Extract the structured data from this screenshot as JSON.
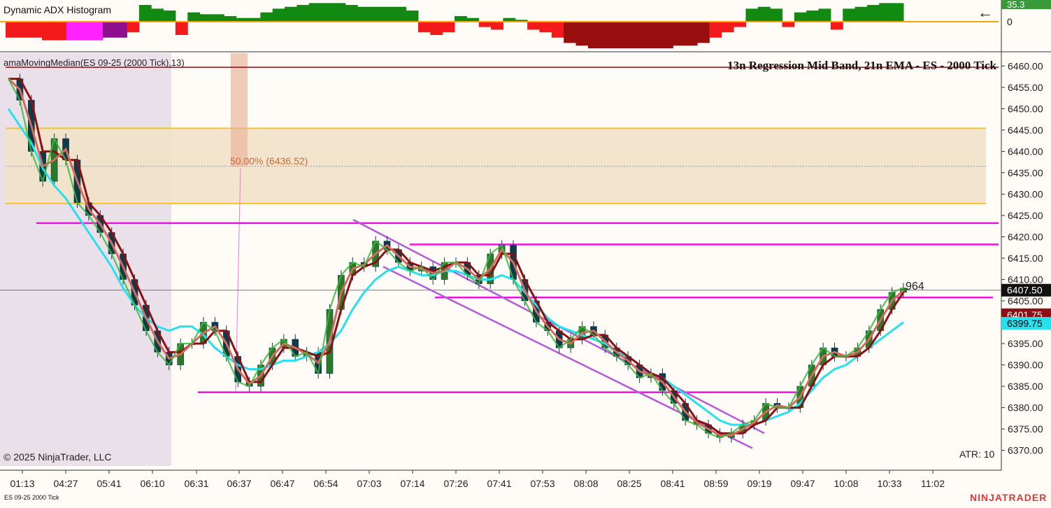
{
  "indicator_panel": {
    "title": "Dynamic ADX Histogram",
    "value_badge": "35.3",
    "zero_label": "0",
    "badge_color": "#3a9a3a"
  },
  "main_panel": {
    "indicator_label": "amaMovingMedian(ES 09-25 (2000 Tick),13)",
    "chart_title": "13n Regression Mid Band, 21n EMA - ES - 2000 Tick",
    "fib_label": "50.00% (6436.52)",
    "bar_count": "964",
    "atr_label": "ATR: 10",
    "copyright": "© 2025 NinjaTrader, LLC",
    "series_tag": "ES 09-25 2000 Tick",
    "brand": "NINJATRADER"
  },
  "price_badges": [
    {
      "label": "6407.50",
      "bg": "#111111",
      "fg": "#ffffff"
    },
    {
      "label": "6401.75",
      "bg": "#8b0f14",
      "fg": "#ffffff"
    },
    {
      "label": "6399.75",
      "bg": "#27e0ee",
      "fg": "#000000"
    }
  ],
  "colors": {
    "background": "#fffbf7",
    "zone_fill": "#f2e2c8",
    "zone_line": "#f4c430",
    "level_line": "#ee11dd",
    "channel": "#b55ad8",
    "ema": "#27e0ee",
    "median": "#8b0f14",
    "regression": "#d46a5a",
    "trend_up": "#3cb83c",
    "candle": "#0e3a4a",
    "session_shade": "#e9e0ea",
    "fib_bar": "#eab09a"
  },
  "chart_data": {
    "type": "candlestick",
    "title": "13n Regression Mid Band, 21n EMA - ES - 2000 Tick",
    "x_ticks": [
      "01:13",
      "04:27",
      "05:41",
      "06:10",
      "06:31",
      "06:37",
      "06:47",
      "06:54",
      "07:03",
      "07:14",
      "07:26",
      "07:41",
      "07:53",
      "08:08",
      "08:25",
      "08:41",
      "08:59",
      "09:19",
      "09:47",
      "10:08",
      "10:33",
      "11:02"
    ],
    "y_ticks": [
      6370,
      6375,
      6380,
      6385,
      6390,
      6395,
      6400,
      6405,
      6410,
      6415,
      6420,
      6425,
      6430,
      6435,
      6440,
      6445,
      6450,
      6455,
      6460
    ],
    "ylim": [
      6366,
      6463
    ],
    "grid": false,
    "last_price": 6407.5,
    "median_value": 6401.75,
    "ema_value": 6399.75,
    "fib_retracement": {
      "percent": 50.0,
      "price": 6436.52
    },
    "zone": {
      "top": 6445.4,
      "bottom": 6427.8
    },
    "horizontal_levels": [
      6459.7,
      6423.2,
      6418.2,
      6405.8,
      6383.6
    ],
    "close_series": [
      6457,
      6452,
      6440,
      6433,
      6443,
      6438,
      6428,
      6425,
      6421,
      6416,
      6410,
      6404,
      6398,
      6393,
      6390,
      6395,
      6395,
      6400,
      6398,
      6392,
      6386,
      6385,
      6390,
      6394,
      6396,
      6392,
      6393,
      6388,
      6403,
      6411,
      6414,
      6413,
      6419,
      6417,
      6414,
      6412,
      6413,
      6410,
      6414,
      6414,
      6411,
      6409,
      6416,
      6418,
      6410,
      6405,
      6400,
      6398,
      6394,
      6396,
      6399,
      6397,
      6394,
      6392,
      6390,
      6387,
      6388,
      6384,
      6381,
      6377,
      6376,
      6374,
      6373,
      6374,
      6376,
      6377,
      6381,
      6380,
      6380,
      6385,
      6390,
      6394,
      6392,
      6392,
      6394,
      6398,
      6403,
      6407,
      6408
    ],
    "ema_series": [
      6450,
      6446,
      6442,
      6436,
      6432,
      6429,
      6425,
      6421,
      6417,
      6413,
      6408,
      6404,
      6401,
      6399,
      6398,
      6399,
      6399,
      6397,
      6394,
      6392,
      6390,
      6389,
      6389,
      6390,
      6391,
      6391,
      6392,
      6393,
      6395,
      6398,
      6403,
      6407,
      6410,
      6412,
      6413,
      6412,
      6411,
      6411,
      6412,
      6412,
      6411,
      6410,
      6410,
      6411,
      6410,
      6407,
      6404,
      6401,
      6399,
      6398,
      6397,
      6396,
      6395,
      6393,
      6392,
      6390,
      6388,
      6387,
      6385,
      6383,
      6381,
      6379,
      6377,
      6376,
      6376,
      6376,
      6377,
      6378,
      6379,
      6381,
      6384,
      6387,
      6389,
      6390,
      6392,
      6394,
      6396,
      6398,
      6400
    ],
    "adx_histogram": [
      -0.6,
      -0.6,
      -0.6,
      -0.7,
      -0.7,
      -0.7,
      -0.7,
      -0.7,
      -0.6,
      -0.6,
      -0.4,
      0.9,
      0.7,
      0.6,
      -0.5,
      0.5,
      0.4,
      0.4,
      0.3,
      0.2,
      0.2,
      0.5,
      0.7,
      0.8,
      0.9,
      1.0,
      1.0,
      1.0,
      0.9,
      0.8,
      0.8,
      0.8,
      0.8,
      0.6,
      -0.4,
      -0.5,
      -0.4,
      0.3,
      0.2,
      -0.2,
      -0.3,
      0.2,
      0.1,
      -0.3,
      -0.4,
      -0.6,
      -0.8,
      -0.9,
      -1.0,
      -1.0,
      -1.0,
      -1.0,
      -1.0,
      -1.0,
      -1.0,
      -0.9,
      -0.9,
      -0.8,
      -0.6,
      -0.4,
      -0.2,
      0.7,
      0.8,
      0.7,
      -0.2,
      0.5,
      0.6,
      0.7,
      -0.3,
      0.7,
      0.8,
      0.9,
      1.0,
      1.0
    ]
  }
}
